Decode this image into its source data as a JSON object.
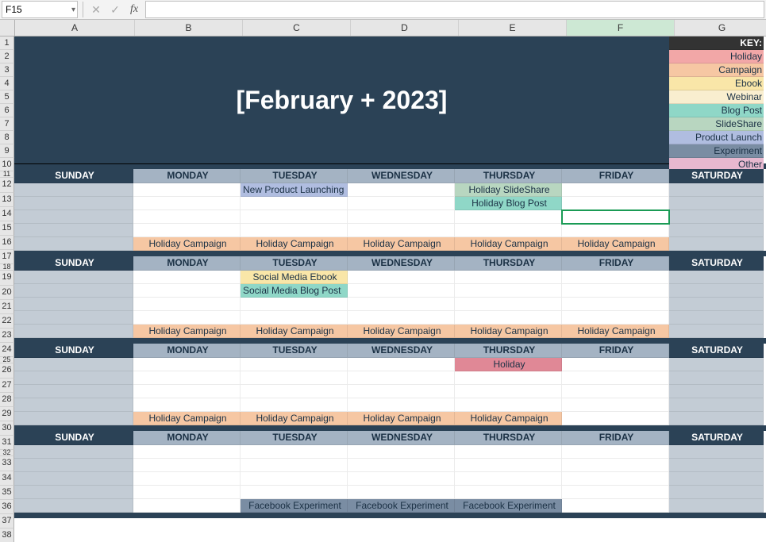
{
  "formula_bar": {
    "cell_ref": "F15",
    "formula": ""
  },
  "columns": [
    "A",
    "B",
    "C",
    "D",
    "E",
    "F",
    "G"
  ],
  "row_numbers": [
    1,
    2,
    3,
    4,
    5,
    6,
    7,
    8,
    9,
    10,
    11,
    12,
    13,
    14,
    15,
    16,
    17,
    18,
    19,
    20,
    21,
    22,
    23,
    24,
    25,
    26,
    27,
    28,
    29,
    30,
    31,
    32,
    33,
    34,
    35,
    36,
    37,
    38
  ],
  "title": "[February + 2023]",
  "key": {
    "header": "KEY:",
    "items": [
      "Holiday",
      "Campaign",
      "Ebook",
      "Webinar",
      "Blog Post",
      "SlideShare",
      "Product Launch",
      "Experiment",
      "Other"
    ]
  },
  "day_labels": [
    "SUNDAY",
    "MONDAY",
    "TUESDAY",
    "WEDNESDAY",
    "THURSDAY",
    "FRIDAY",
    "SATURDAY"
  ],
  "weeks": [
    {
      "cells": {
        "tuesday": [
          {
            "text": "New Product Launching",
            "style": "evt-launch"
          }
        ],
        "thursday": [
          {
            "text": "Holiday SlideShare",
            "style": "evt-slideshare"
          },
          {
            "text": "Holiday Blog Post",
            "style": "evt-blog"
          }
        ]
      },
      "bottom": {
        "monday": "Holiday Campaign",
        "tuesday": "Holiday Campaign",
        "wednesday": "Holiday Campaign",
        "thursday": "Holiday Campaign",
        "friday": "Holiday Campaign"
      }
    },
    {
      "cells": {
        "tuesday": [
          {
            "text": "Social Media Ebook",
            "style": "evt-ebook"
          },
          {
            "text": "Social Media Blog Post",
            "style": "evt-blog"
          }
        ]
      },
      "bottom": {
        "monday": "Holiday Campaign",
        "tuesday": "Holiday Campaign",
        "wednesday": "Holiday Campaign",
        "thursday": "Holiday Campaign",
        "friday": "Holiday Campaign"
      }
    },
    {
      "cells": {
        "thursday": [
          {
            "text": "Holiday",
            "style": "evt-holiday"
          }
        ]
      },
      "bottom": {
        "monday": "Holiday Campaign",
        "tuesday": "Holiday Campaign",
        "wednesday": "Holiday Campaign",
        "thursday": "Holiday Campaign"
      }
    },
    {
      "cells": {},
      "bottom_style": "evt-experiment",
      "bottom": {
        "tuesday": "Facebook Experiment",
        "wednesday": "Facebook Experiment",
        "thursday": "Facebook Experiment"
      }
    }
  ],
  "active_cell": "F15"
}
